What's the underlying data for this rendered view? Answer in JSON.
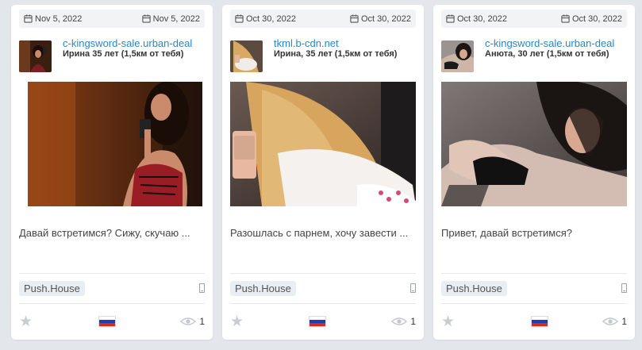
{
  "cards": [
    {
      "date_start": "Nov 5, 2022",
      "date_end": "Nov 5, 2022",
      "domain": "c-kingsword-sale.urban-deal",
      "person": "Ирина 35 лет (1,5км от тебя)",
      "description": "Давай встретимся? Сижу, скучаю ...",
      "network": "Push.House",
      "views": "1"
    },
    {
      "date_start": "Oct 30, 2022",
      "date_end": "Oct 30, 2022",
      "domain": "tkml.b-cdn.net",
      "person": "Ирина, 35 лет (1,5км от тебя)",
      "description": "Разошлась с парнем, хочу завести ...",
      "network": "Push.House",
      "views": "1"
    },
    {
      "date_start": "Oct 30, 2022",
      "date_end": "Oct 30, 2022",
      "domain": "c-kingsword-sale.urban-deal",
      "person": "Анюта, 30 лет (1,5км от тебя)",
      "description": "Привет, давай встретимся?",
      "network": "Push.House",
      "views": "1"
    }
  ],
  "icons": {
    "date": "calendar-icon",
    "device": "phone-icon",
    "favorite": "star-icon",
    "country": "russia-flag-icon",
    "views": "eye-icon"
  },
  "colors": {
    "background": "#e3e6ea",
    "link": "#2d86c3",
    "tag_bg": "#e8eef3"
  }
}
